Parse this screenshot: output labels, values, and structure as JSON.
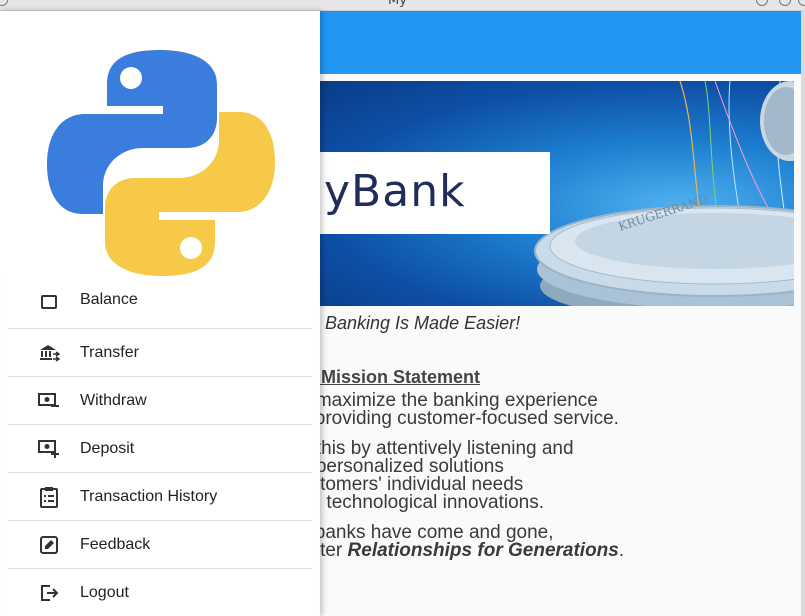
{
  "window": {
    "title": "My"
  },
  "drawer": {
    "logo_icon": "python-logo-icon",
    "items": [
      {
        "label": "Balance",
        "icon": "balance-icon"
      },
      {
        "label": "Transfer",
        "icon": "bank-transfer-icon"
      },
      {
        "label": "Withdraw",
        "icon": "cash-minus-icon"
      },
      {
        "label": "Deposit",
        "icon": "cash-plus-icon"
      },
      {
        "label": "Transaction History",
        "icon": "clipboard-list-icon"
      },
      {
        "label": "Feedback",
        "icon": "pencil-box-icon"
      },
      {
        "label": "Logout",
        "icon": "logout-icon"
      }
    ]
  },
  "banner": {
    "logo_text": "yBank",
    "coin_text": "KRUGERRAND"
  },
  "content": {
    "tagline": "Banking Is Made Easier!",
    "mission_title": "ur Mission Statement",
    "p1": [
      "o maximize the banking experience",
      "y providing customer-focused service."
    ],
    "p2": [
      "n this by attentively listening and",
      "g personalized solutions",
      "ustomers' individual needs",
      "ng technological innovations."
    ],
    "p3_line1": "y banks have come and gone,",
    "p3_line2_prefix": "oster ",
    "p3_line2_emph": "Relationships for Generations",
    "p3_line2_suffix": "."
  },
  "colors": {
    "topbar": "#2196f3",
    "python_blue": "#3b7ddd",
    "python_yellow": "#f7c948"
  }
}
